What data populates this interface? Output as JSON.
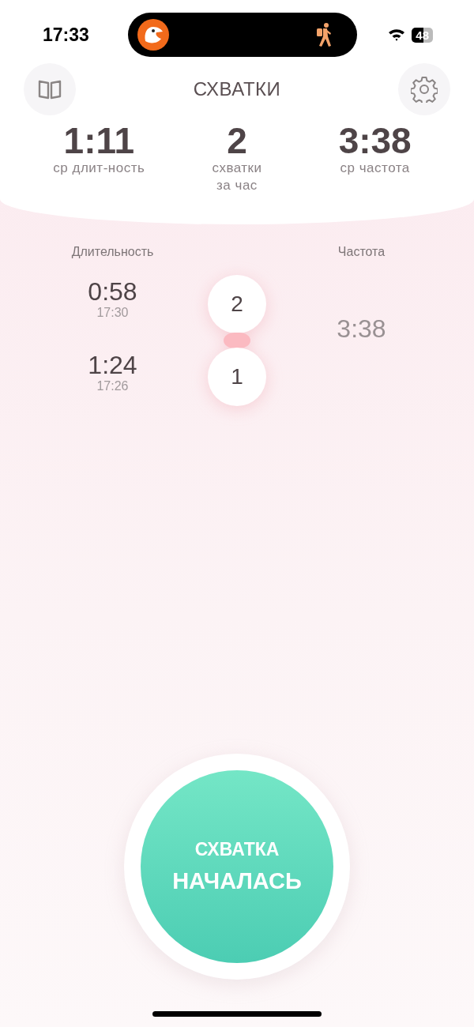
{
  "status_bar": {
    "time": "17:33",
    "battery": "48"
  },
  "header": {
    "title": "СХВАТКИ"
  },
  "stats": [
    {
      "value": "1:11",
      "label": "ср длит-ность"
    },
    {
      "value": "2",
      "label": "схватки\nза час"
    },
    {
      "value": "3:38",
      "label": "ср частота"
    }
  ],
  "list": {
    "duration_heading": "Длительность",
    "frequency_heading": "Частота",
    "contractions": [
      {
        "number": "2",
        "duration": "0:58",
        "start": "17:30"
      },
      {
        "number": "1",
        "duration": "1:24",
        "start": "17:26"
      }
    ],
    "intervals": [
      "3:38"
    ]
  },
  "main_button": {
    "line_1": "СХВАТКА",
    "line_2": "НАЧАЛАСЬ"
  }
}
